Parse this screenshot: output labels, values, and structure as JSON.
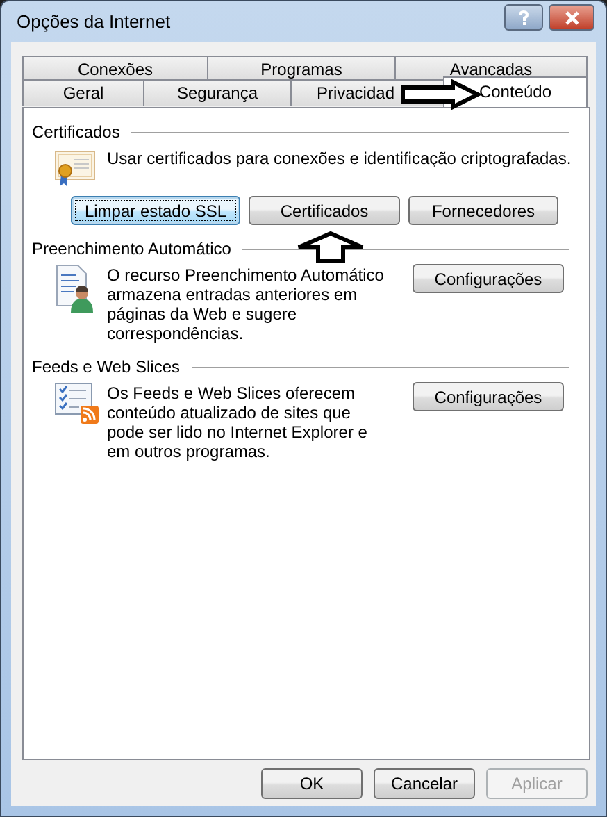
{
  "window": {
    "title": "Opções da Internet"
  },
  "tab_rows": [
    {
      "tabs": [
        {
          "label": "Conexões",
          "selected": false
        },
        {
          "label": "Programas",
          "selected": false
        },
        {
          "label": "Avançadas",
          "selected": false
        }
      ]
    },
    {
      "tabs": [
        {
          "label": "Geral",
          "selected": false
        },
        {
          "label": "Segurança",
          "selected": false
        },
        {
          "label": "Privacidad",
          "selected": false
        },
        {
          "label": "Conteúdo",
          "selected": true
        }
      ]
    }
  ],
  "sections": [
    {
      "kind": "certificate",
      "title": "Certificados",
      "description": "Usar certificados para conexões e identificação criptografadas.",
      "buttons": [
        {
          "label": "Limpar estado SSL",
          "focused": true
        },
        {
          "label": "Certificados",
          "focused": false
        },
        {
          "label": "Fornecedores",
          "focused": false
        }
      ]
    },
    {
      "kind": "autocomplete",
      "title": "Preenchimento Automático",
      "description": "O recurso Preenchimento Automático armazena entradas anteriores em páginas da Web e sugere correspondências.",
      "buttons": [
        {
          "label": "Configurações",
          "focused": false
        }
      ]
    },
    {
      "kind": "feeds",
      "title": "Feeds e Web Slices",
      "description": "Os Feeds e Web Slices oferecem conteúdo atualizado de sites que pode ser lido no Internet Explorer e em outros programas.",
      "buttons": [
        {
          "label": "Configurações",
          "focused": false
        }
      ]
    }
  ],
  "footer_buttons": [
    {
      "label": "OK",
      "disabled": false
    },
    {
      "label": "Cancelar",
      "disabled": false
    },
    {
      "label": "Aplicar",
      "disabled": true
    }
  ]
}
